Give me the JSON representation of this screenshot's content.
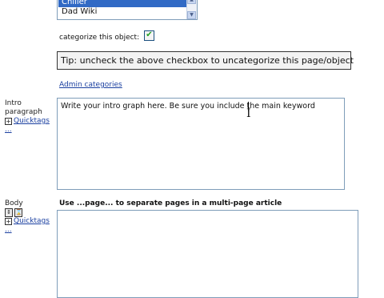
{
  "categories": {
    "selected": "Chiller",
    "items": [
      "Chiller",
      "Dad Wiki"
    ]
  },
  "categorize": {
    "label": "categorize this object:",
    "checked": true
  },
  "tip": "Tip: uncheck the above checkbox to uncategorize this page/object",
  "admin_link": "Admin categories",
  "intro": {
    "label_line1": "Intro",
    "label_line2": "paragraph",
    "quicktags": "Quicktags",
    "more": "...",
    "value": "Write your intro graph here. Be sure you include the main keyword"
  },
  "body": {
    "label": "Body",
    "quicktags": "Quicktags",
    "more": "...",
    "hint": "Use ...page... to separate pages in a multi-page article",
    "value": ""
  }
}
